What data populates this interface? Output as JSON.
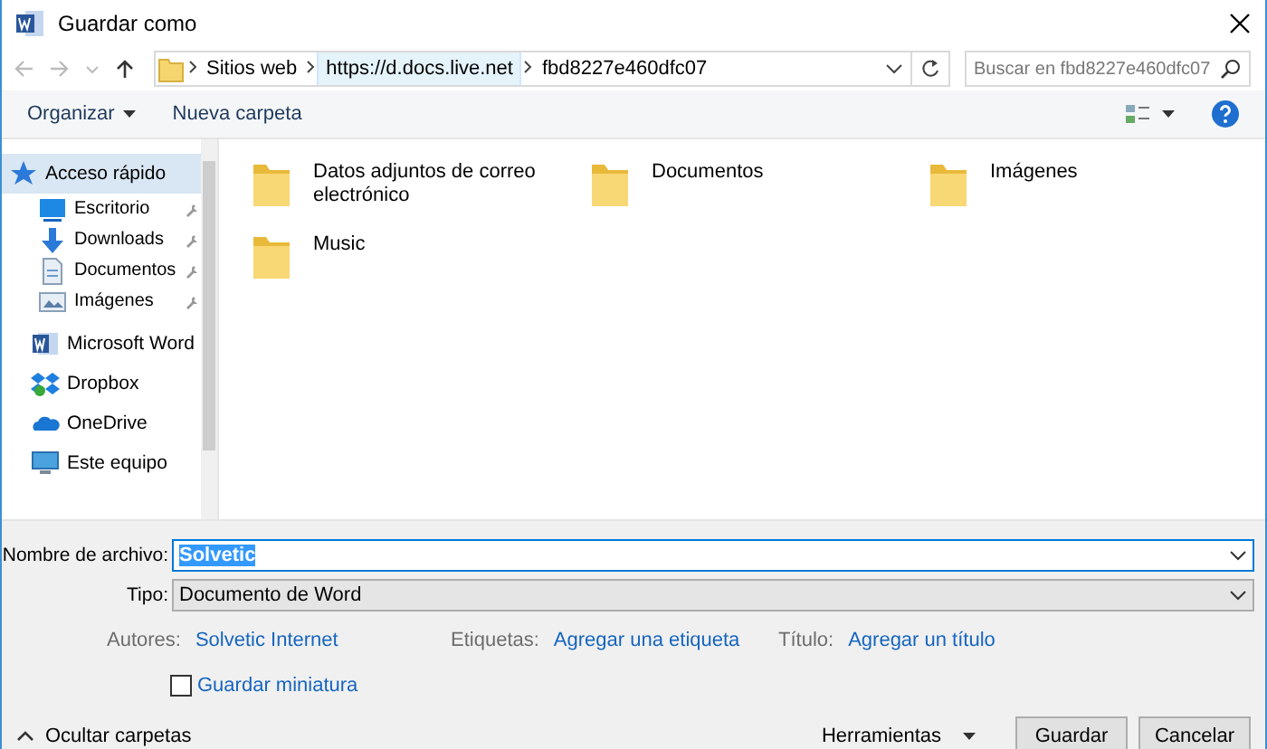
{
  "window": {
    "title": "Guardar como"
  },
  "address": {
    "breadcrumbs": [
      {
        "label": "Sitios web",
        "selected": false
      },
      {
        "label": "https://d.docs.live.net",
        "selected": true
      },
      {
        "label": "fbd8227e460dfc07",
        "selected": false
      }
    ]
  },
  "search": {
    "placeholder": "Buscar en fbd8227e460dfc07"
  },
  "toolbar": {
    "buttons": [
      {
        "label": "Organizar",
        "kind": "menu"
      },
      {
        "label": "Nueva carpeta",
        "kind": "plain"
      }
    ]
  },
  "sidebar": {
    "items": [
      {
        "label": "Acceso rápido",
        "kind": "star",
        "selected": true,
        "children": [
          {
            "label": "Escritorio",
            "kind": "desktop",
            "pinned": true
          },
          {
            "label": "Downloads",
            "kind": "download",
            "pinned": true
          },
          {
            "label": "Documentos",
            "kind": "document",
            "pinned": true
          },
          {
            "label": "Imágenes",
            "kind": "images",
            "pinned": true
          }
        ]
      },
      {
        "label": "Microsoft Word",
        "kind": "word",
        "selected": false
      },
      {
        "label": "Dropbox",
        "kind": "dropbox",
        "selected": false
      },
      {
        "label": "OneDrive",
        "kind": "cloud",
        "selected": false
      },
      {
        "label": "Este equipo",
        "kind": "computer",
        "selected": false
      }
    ]
  },
  "folders": [
    {
      "name": "Datos adjuntos de correo electrónico"
    },
    {
      "name": "Documentos"
    },
    {
      "name": "Imágenes"
    },
    {
      "name": "Music"
    }
  ],
  "form": {
    "filename": {
      "label": "Nombre de archivo:",
      "value": "Solvetic",
      "text_selected": true
    },
    "type": {
      "label": "Tipo:",
      "value": "Documento de Word"
    },
    "metadata": [
      {
        "label": "Autores:",
        "value": "Solvetic Internet"
      },
      {
        "label": "Etiquetas:",
        "value": "Agregar una etiqueta"
      },
      {
        "label": "Título:",
        "value": "Agregar un título"
      }
    ],
    "thumbnail": {
      "label": "Guardar miniatura",
      "checked": false
    }
  },
  "footer": {
    "hide_folders": "Ocultar carpetas",
    "tools": "Herramientas",
    "buttons": [
      "Guardar",
      "Cancelar"
    ]
  }
}
